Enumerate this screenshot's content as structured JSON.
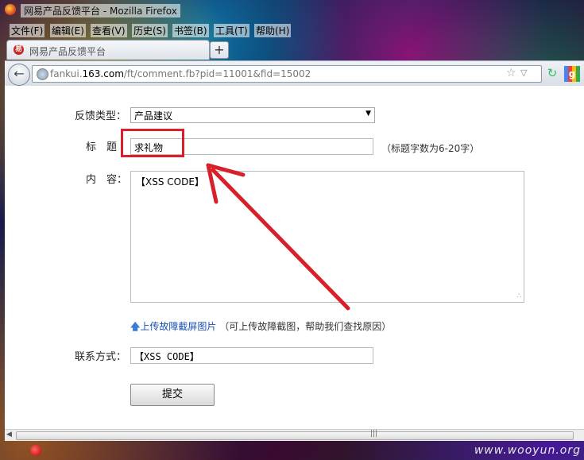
{
  "window": {
    "title": "网易产品反馈平台 - Mozilla Firefox"
  },
  "menu": [
    "文件(F)",
    "编辑(E)",
    "查看(V)",
    "历史(S)",
    "书签(B)",
    "工具(T)",
    "帮助(H)"
  ],
  "tab": {
    "label": "网易产品反馈平台",
    "new_tab": "+"
  },
  "nav": {
    "url_prefix": "fankui.",
    "url_domain": "163.com",
    "url_path": "/ft/comment.fb?pid=11001&fid=15002",
    "google": "g"
  },
  "form": {
    "type_label": "反馈类型：",
    "type_value": "产品建议",
    "title_label": "标　题",
    "title_value": "求礼物",
    "title_hint": "（标题字数为6-20字）",
    "content_label": "内　容：",
    "content_value": "【XSS CODE】",
    "upload_link": "上传故障截屏图片",
    "upload_note": "（可上传故障截图，帮助我们查找原因）",
    "contact_label": "联系方式：",
    "contact_value": "【XSS CODE】",
    "submit_label": "提交"
  },
  "footer": {
    "watermark": "www.wooyun.org"
  },
  "colors": {
    "annotation_red": "#d8202a",
    "link_blue": "#1a4fb5"
  }
}
